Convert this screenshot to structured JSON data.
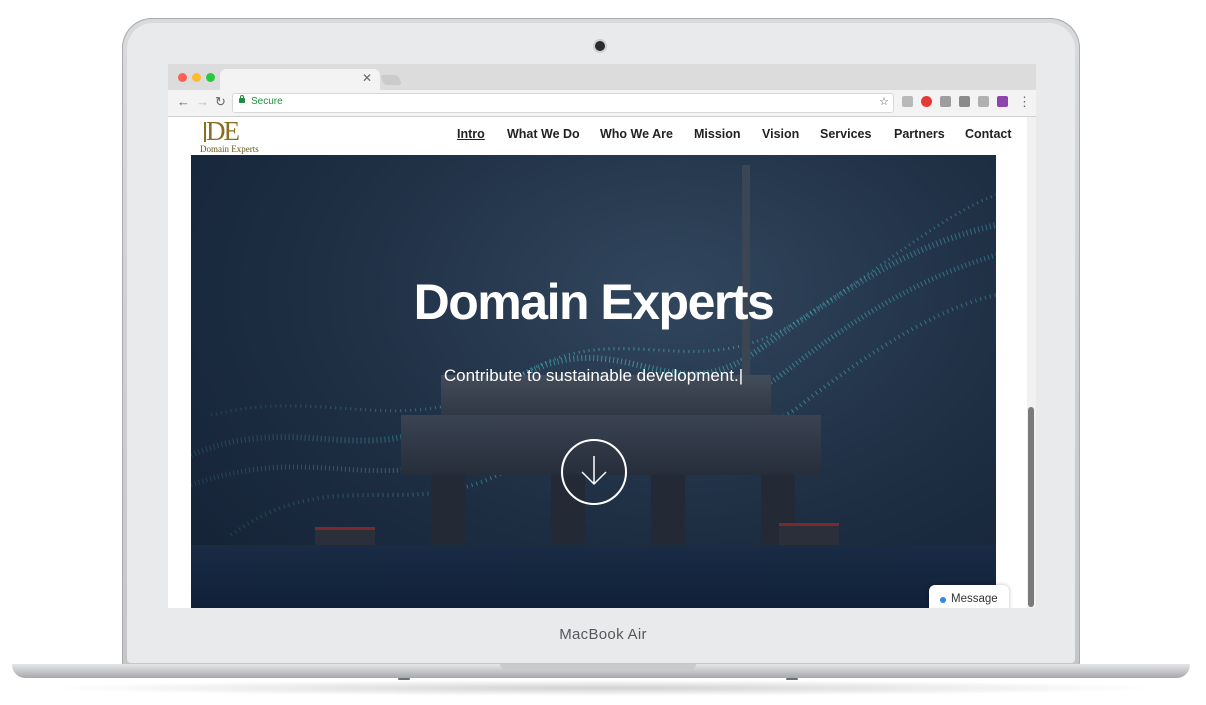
{
  "device": {
    "brand_label": "MacBook Air"
  },
  "browser": {
    "address": {
      "secure_label": "Secure"
    },
    "extension_colors": [
      "#b9b9b9",
      "#e53935",
      "#9e9e9e",
      "#8a8a8a",
      "#b0b0b0",
      "#8e44ad"
    ]
  },
  "website": {
    "logo": {
      "mark": "DE",
      "name": "Domain Experts"
    },
    "nav": {
      "items": [
        "Intro",
        "What We Do",
        "Who We Are",
        "Mission",
        "Vision",
        "Services",
        "Partners",
        "Contact"
      ],
      "active": "Intro"
    },
    "hero": {
      "title": "Domain Experts",
      "subtitle": "Contribute to sustainable development.|"
    },
    "message_widget": {
      "label": "Message"
    }
  },
  "colors": {
    "logo_gold": "#8b6d1f",
    "hero_bg": "#1d2d42",
    "particles": "#4fd1d9",
    "secure_green": "#1e8e3e"
  }
}
